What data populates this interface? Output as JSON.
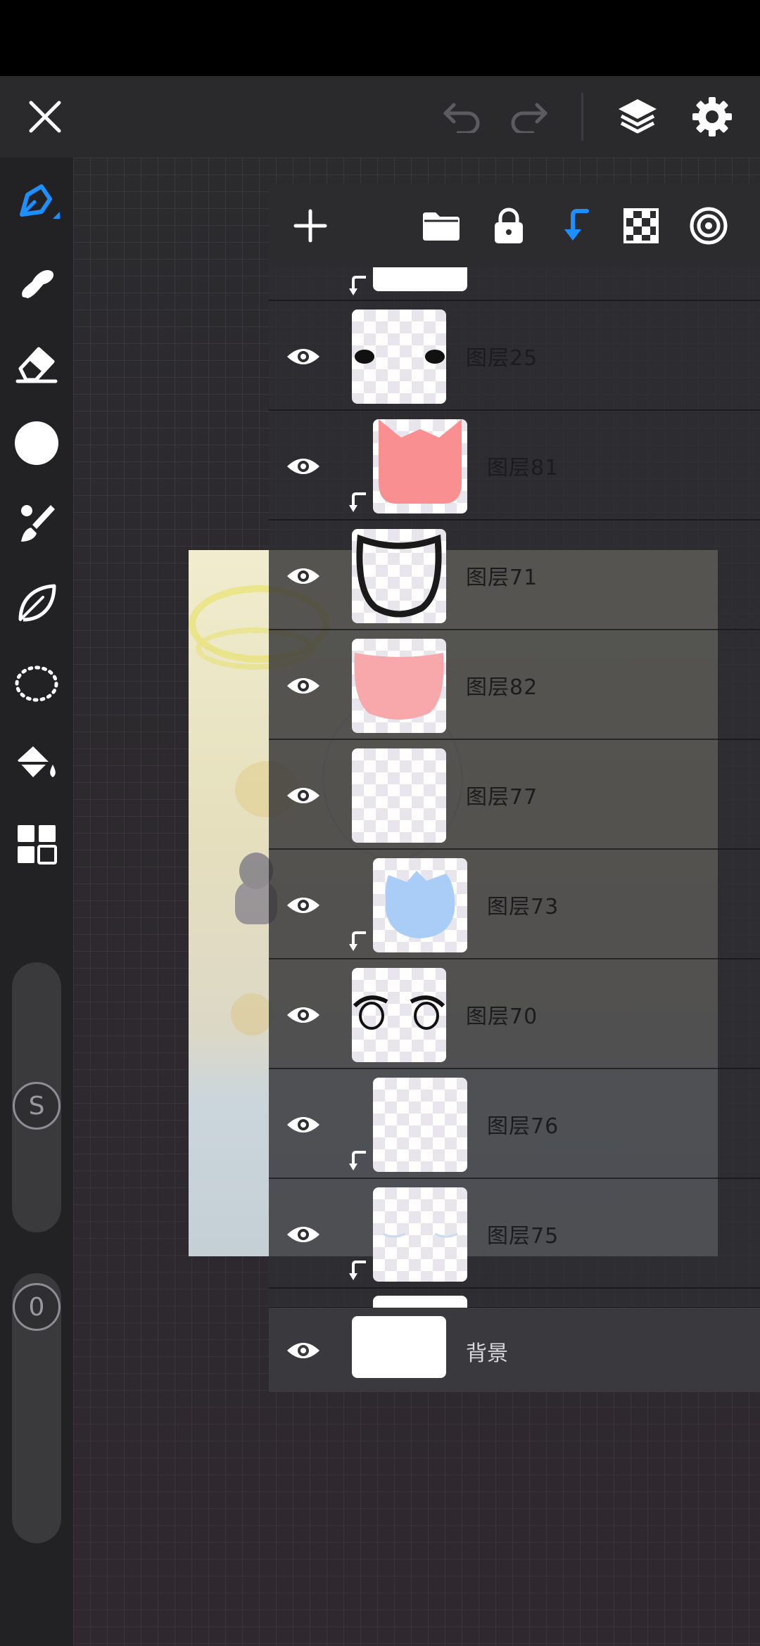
{
  "colors": {
    "accent": "#1e8fff",
    "panel": "#2c2c2f",
    "icon": "#ffffff"
  },
  "toolbar": {
    "close_icon": "close-icon",
    "undo_icon": "undo-icon",
    "redo_icon": "redo-icon",
    "layers_icon": "layers-icon",
    "settings_icon": "gear-icon"
  },
  "rail": {
    "tools": [
      "pen-icon",
      "smudge-icon",
      "eraser-icon",
      "color-circle-icon",
      "brush-icon",
      "lasso-leaf-icon",
      "selection-icon",
      "fill-bucket-icon",
      "grid-menu-icon"
    ],
    "size_label": "S",
    "opacity_label": "0"
  },
  "layers_panel": {
    "header_icons": [
      "add-icon",
      "folder-icon",
      "lock-icon",
      "clip-arrow-icon",
      "transparency-icon",
      "blend-icon"
    ],
    "layers": [
      {
        "name": "图层25",
        "clipped": false
      },
      {
        "name": "图层81",
        "clipped": true
      },
      {
        "name": "图层71",
        "clipped": false
      },
      {
        "name": "图层82",
        "clipped": false
      },
      {
        "name": "图层77",
        "clipped": false
      },
      {
        "name": "图层73",
        "clipped": true
      },
      {
        "name": "图层70",
        "clipped": false
      },
      {
        "name": "图层76",
        "clipped": true
      },
      {
        "name": "图层75",
        "clipped": true
      }
    ],
    "background": {
      "name": "背景"
    }
  }
}
